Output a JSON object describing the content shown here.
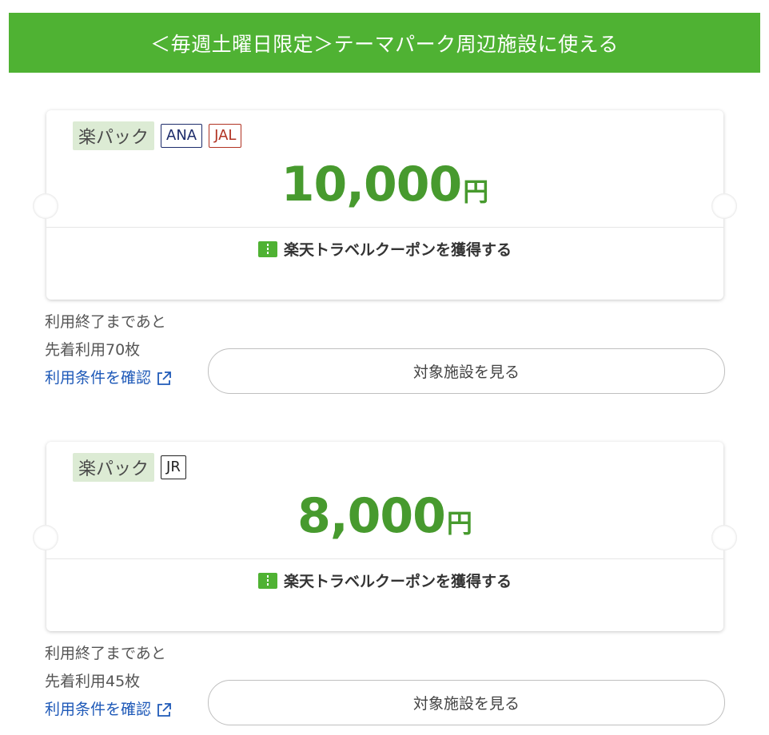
{
  "banner": {
    "title": "＜毎週土曜日限定＞テーマパーク周辺施設に使える"
  },
  "coupons": [
    {
      "pack_label": "楽パック",
      "tags": [
        "ANA",
        "JAL"
      ],
      "amount": "10,000",
      "unit": "円",
      "get_label": "楽天トラベルクーポンを獲得する",
      "remaining_label": "利用終了まであと",
      "count_label": "先着利用70枚",
      "terms_link": "利用条件を確認",
      "view_button": "対象施設を見る"
    },
    {
      "pack_label": "楽パック",
      "tags": [
        "JR"
      ],
      "amount": "8,000",
      "unit": "円",
      "get_label": "楽天トラベルクーポンを獲得する",
      "remaining_label": "利用終了まであと",
      "count_label": "先着利用45枚",
      "terms_link": "利用条件を確認",
      "view_button": "対象施設を見る"
    }
  ],
  "colors": {
    "brand_green": "#4fb233",
    "amount_green": "#479a2e",
    "link_blue": "#1e59b8",
    "ana_navy": "#1d2c6b",
    "jal_red": "#b13222"
  },
  "icons": {
    "ticket": "ticket-icon",
    "external": "external-link-icon"
  }
}
